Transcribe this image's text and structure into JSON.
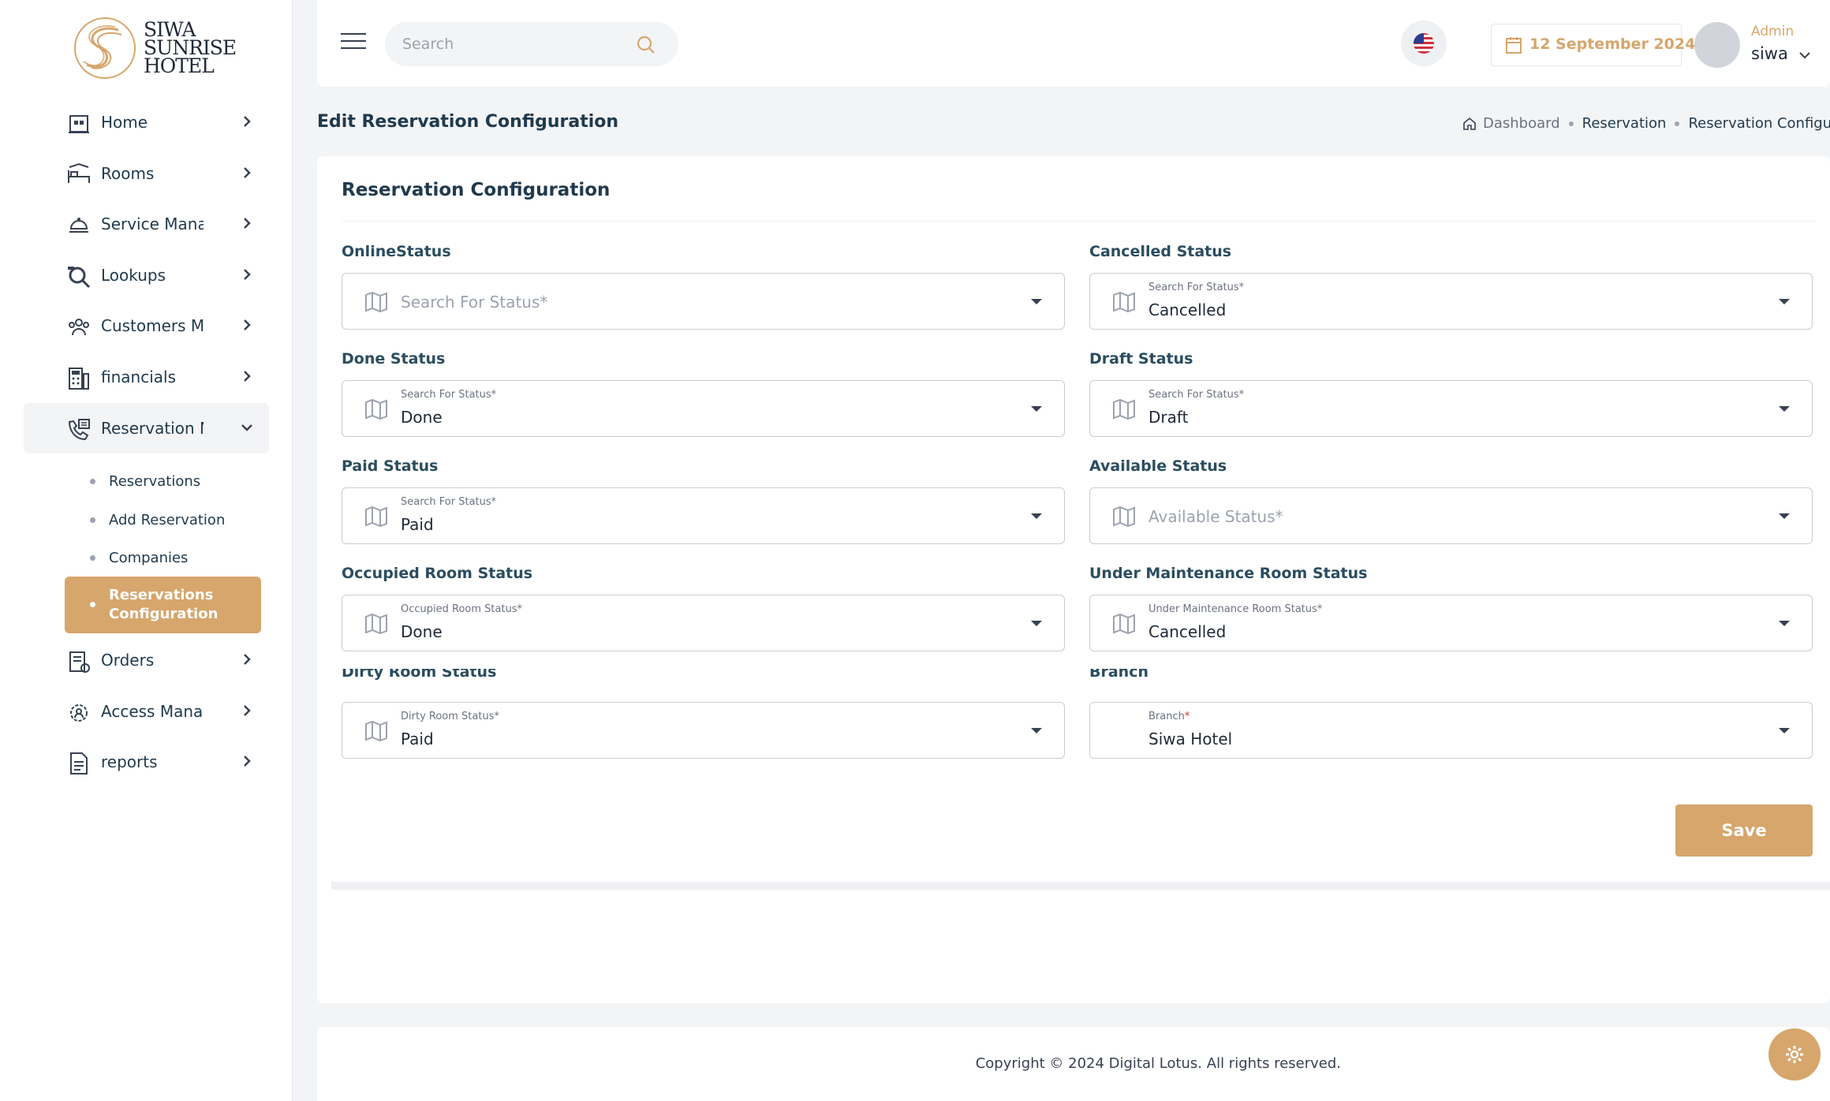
{
  "brand": {
    "logo_lines": [
      "SIWA",
      "SUNRISE",
      "HOTEL"
    ],
    "accent_color": "#d6a66c"
  },
  "sidebar": {
    "items": [
      {
        "label": "Home",
        "icon": "home-icon"
      },
      {
        "label": "Rooms",
        "icon": "bed-icon"
      },
      {
        "label": "Service Mana",
        "icon": "service-bell-icon"
      },
      {
        "label": "Lookups",
        "icon": "magnifier-icon"
      },
      {
        "label": "Customers M",
        "icon": "customers-icon"
      },
      {
        "label": "financials",
        "icon": "calculator-icon"
      },
      {
        "label": "Reservation M",
        "icon": "reservation-phone-icon"
      },
      {
        "label": "Orders",
        "icon": "orders-icon"
      },
      {
        "label": "Access Manag",
        "icon": "access-gear-icon"
      },
      {
        "label": "reports",
        "icon": "report-icon"
      }
    ],
    "reservation_sub": [
      {
        "label": "Reservations"
      },
      {
        "label": "Add Reservation"
      },
      {
        "label": "Companies"
      },
      {
        "label": "Reservations Configuration",
        "active": true
      }
    ]
  },
  "topbar": {
    "search_placeholder": "Search",
    "date": "12 September 2024",
    "user_role": "Admin",
    "user_name": "siwa"
  },
  "page": {
    "title": "Edit Reservation Configuration",
    "breadcrumb": [
      "Dashboard",
      "Reservation",
      "Reservation Configuratio"
    ]
  },
  "card": {
    "title": "Reservation Configuration",
    "fields": {
      "online_status": {
        "label": "OnlineStatus",
        "placeholder": "Search For Status*"
      },
      "cancelled_status": {
        "label": "Cancelled Status",
        "floating": "Search For Status*",
        "value": "Cancelled"
      },
      "done_status": {
        "label": "Done Status",
        "floating": "Search For Status*",
        "value": "Done"
      },
      "draft_status": {
        "label": "Draft Status",
        "floating": "Search For Status*",
        "value": "Draft"
      },
      "paid_status": {
        "label": "Paid Status",
        "floating": "Search For Status*",
        "value": "Paid"
      },
      "available_status": {
        "label": "Available Status",
        "placeholder": "Available Status*"
      },
      "occupied_room_status": {
        "label": "Occupied Room Status",
        "floating": "Occupied Room Status*",
        "value": "Done"
      },
      "under_maintenance_room_status": {
        "label": "Under Maintenance Room Status",
        "floating": "Under Maintenance Room Status*",
        "value": "Cancelled"
      },
      "dirty_room_status": {
        "label": "Dirty Room Status",
        "floating": "Dirty Room Status*",
        "value": "Paid"
      },
      "branch": {
        "label": "Branch",
        "floating": "Branch",
        "value": "Siwa Hotel"
      }
    },
    "save_label": "Save"
  },
  "footer": {
    "copyright": "Copyright © 2024 Digital Lotus. All rights reserved."
  }
}
